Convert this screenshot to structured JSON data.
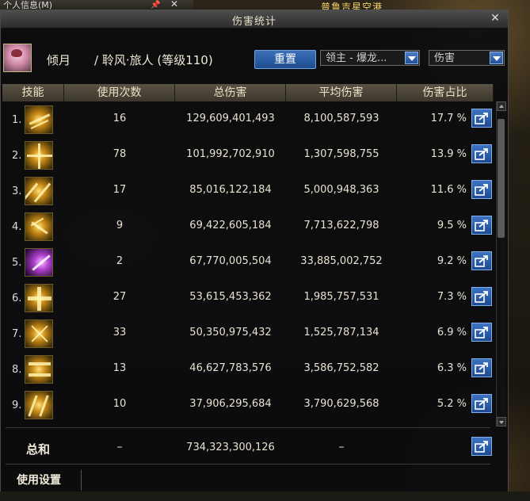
{
  "background": {
    "top_left_title": "个人信息(M)",
    "top_right_title": "普鲁吉星空港"
  },
  "window": {
    "title": "伤害统计"
  },
  "character": {
    "name": "倾月",
    "info": "/ 聆风·旅人 (等级110)"
  },
  "controls": {
    "reset_label": "重置",
    "target_select": "领主 - 爆龙...",
    "type_select": "伤害"
  },
  "columns": {
    "skill": "技能",
    "uses": "使用次数",
    "total": "总伤害",
    "avg": "平均伤害",
    "share": "伤害占比"
  },
  "rows": [
    {
      "rank": "1.",
      "uses": "16",
      "total": "129,609,401,493",
      "avg": "8,100,587,593",
      "pct": "17.7 %"
    },
    {
      "rank": "2.",
      "uses": "78",
      "total": "101,992,702,910",
      "avg": "1,307,598,755",
      "pct": "13.9 %"
    },
    {
      "rank": "3.",
      "uses": "17",
      "total": "85,016,122,184",
      "avg": "5,000,948,363",
      "pct": "11.6 %"
    },
    {
      "rank": "4.",
      "uses": "9",
      "total": "69,422,605,184",
      "avg": "7,713,622,798",
      "pct": "9.5 %"
    },
    {
      "rank": "5.",
      "uses": "2",
      "total": "67,770,005,504",
      "avg": "33,885,002,752",
      "pct": "9.2 %"
    },
    {
      "rank": "6.",
      "uses": "27",
      "total": "53,615,453,362",
      "avg": "1,985,757,531",
      "pct": "7.3 %"
    },
    {
      "rank": "7.",
      "uses": "33",
      "total": "50,350,975,432",
      "avg": "1,525,787,134",
      "pct": "6.9 %"
    },
    {
      "rank": "8.",
      "uses": "13",
      "total": "46,627,783,576",
      "avg": "3,586,752,582",
      "pct": "6.3 %"
    },
    {
      "rank": "9.",
      "uses": "10",
      "total": "37,906,295,684",
      "avg": "3,790,629,568",
      "pct": "5.2 %"
    }
  ],
  "summary": {
    "label": "总和",
    "uses": "–",
    "total": "734,323,300,126",
    "avg": "–"
  },
  "footer": {
    "settings_label": "使用设置"
  }
}
